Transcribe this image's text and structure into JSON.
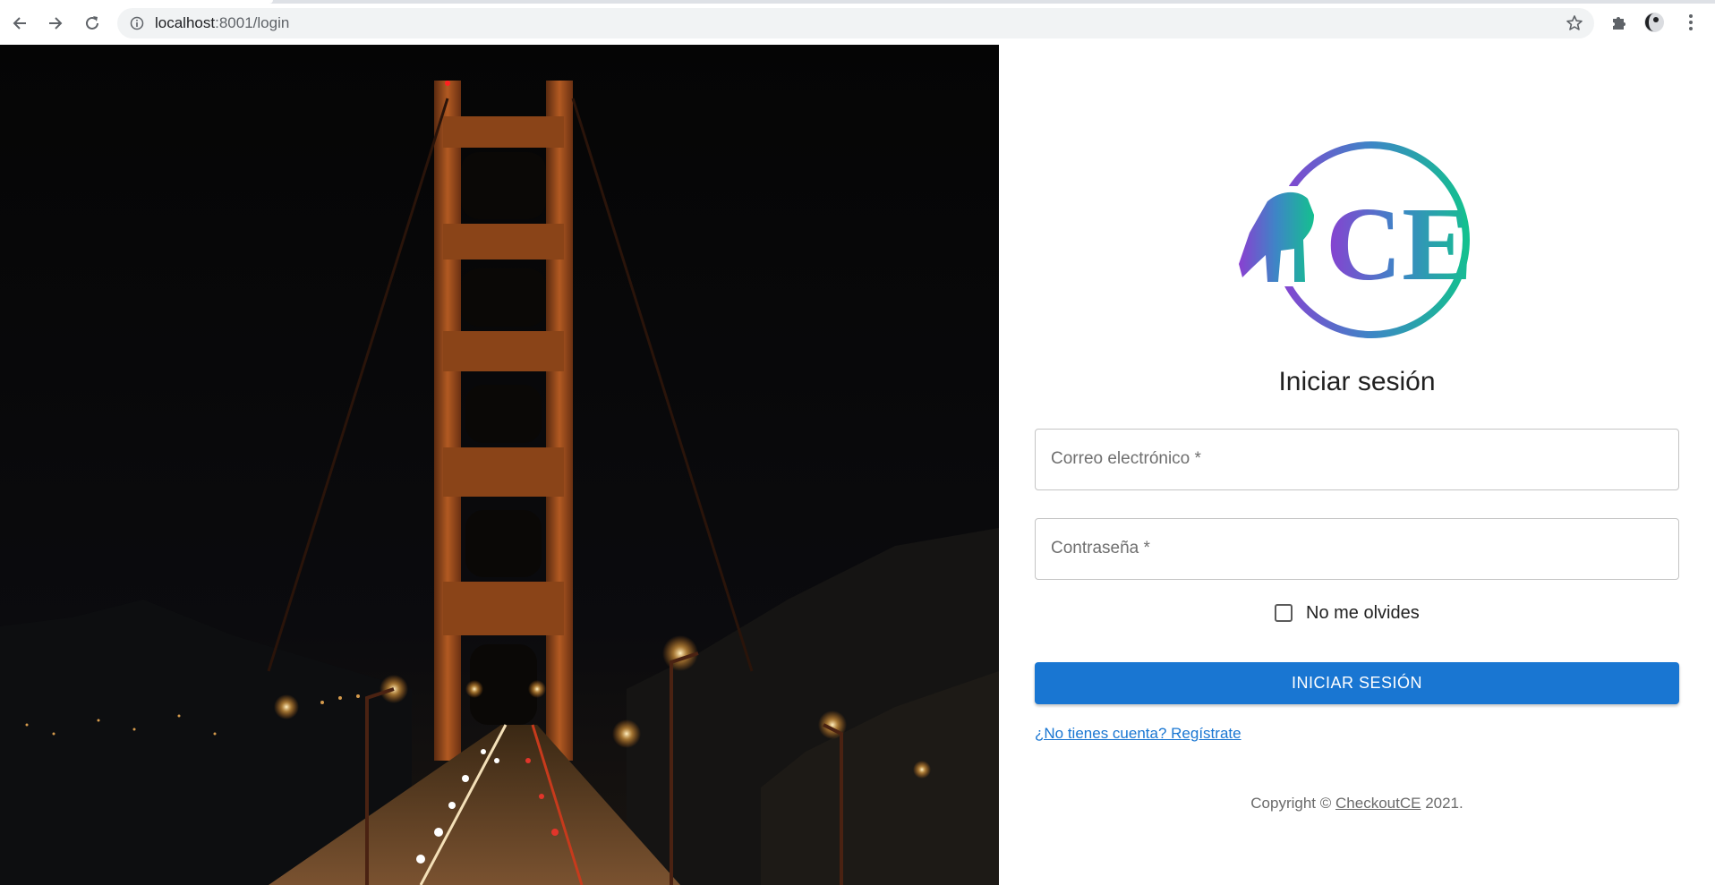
{
  "browser": {
    "url_host": "localhost",
    "url_port": ":8001",
    "url_path": "/login"
  },
  "login": {
    "logo_text": "CE",
    "title": "Iniciar sesión",
    "email_placeholder": "Correo electrónico *",
    "password_placeholder": "Contraseña *",
    "remember_label": "No me olvides",
    "remember_checked": false,
    "submit_label": "INICIAR SESIÓN",
    "signup_link": "¿No tienes cuenta? Regístrate",
    "copyright_prefix": "Copyright ©",
    "copyright_link": "CheckoutCE",
    "copyright_suffix": "2021."
  },
  "colors": {
    "primary": "#1976d2",
    "logo_gradient_start": "#8a3fd1",
    "logo_gradient_end": "#14c08f"
  },
  "icons": [
    "back-arrow-icon",
    "forward-arrow-icon",
    "reload-icon",
    "info-icon",
    "star-icon",
    "extensions-icon",
    "profile-avatar-icon",
    "menu-dots-icon",
    "pug-icon"
  ]
}
